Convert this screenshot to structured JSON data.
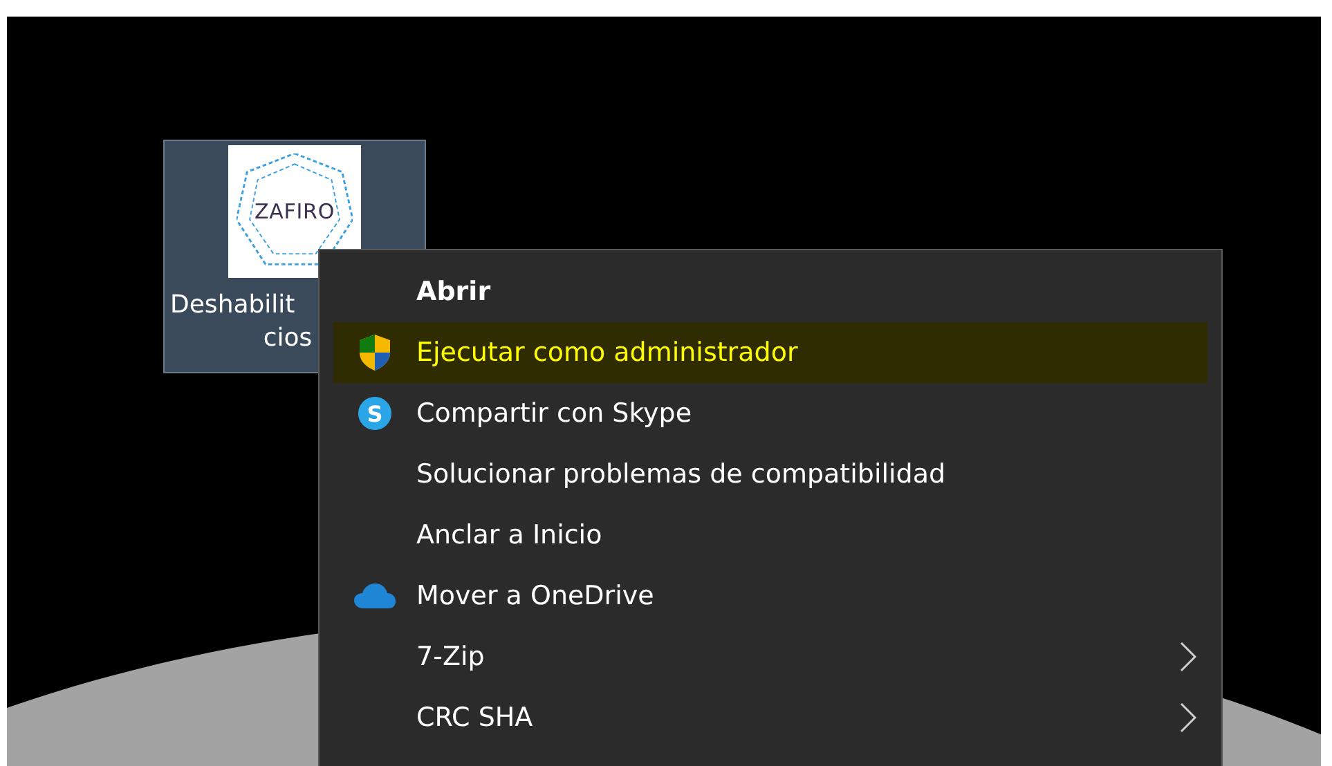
{
  "desktop_icon": {
    "logo_text": "ZAFIRO",
    "label_lines": [
      "Deshabilit",
      "cios"
    ],
    "selected": true
  },
  "context_menu": {
    "items": [
      {
        "label": "Abrir",
        "kind": "plain",
        "default": true,
        "selected": false,
        "submenu": false
      },
      {
        "label": "Ejecutar como administrador",
        "kind": "shield",
        "default": false,
        "selected": true,
        "submenu": false
      },
      {
        "label": "Compartir con Skype",
        "kind": "skype",
        "icon_text": "S",
        "default": false,
        "selected": false,
        "submenu": false
      },
      {
        "label": "Solucionar problemas de compatibilidad",
        "kind": "plain",
        "default": false,
        "selected": false,
        "submenu": false
      },
      {
        "label": "Anclar a Inicio",
        "kind": "plain",
        "default": false,
        "selected": false,
        "submenu": false
      },
      {
        "label": "Mover a OneDrive",
        "kind": "cloud",
        "default": false,
        "selected": false,
        "submenu": false
      },
      {
        "label": "7-Zip",
        "kind": "plain",
        "default": false,
        "selected": false,
        "submenu": true
      },
      {
        "label": "CRC SHA",
        "kind": "plain",
        "default": false,
        "selected": false,
        "submenu": true
      }
    ]
  }
}
